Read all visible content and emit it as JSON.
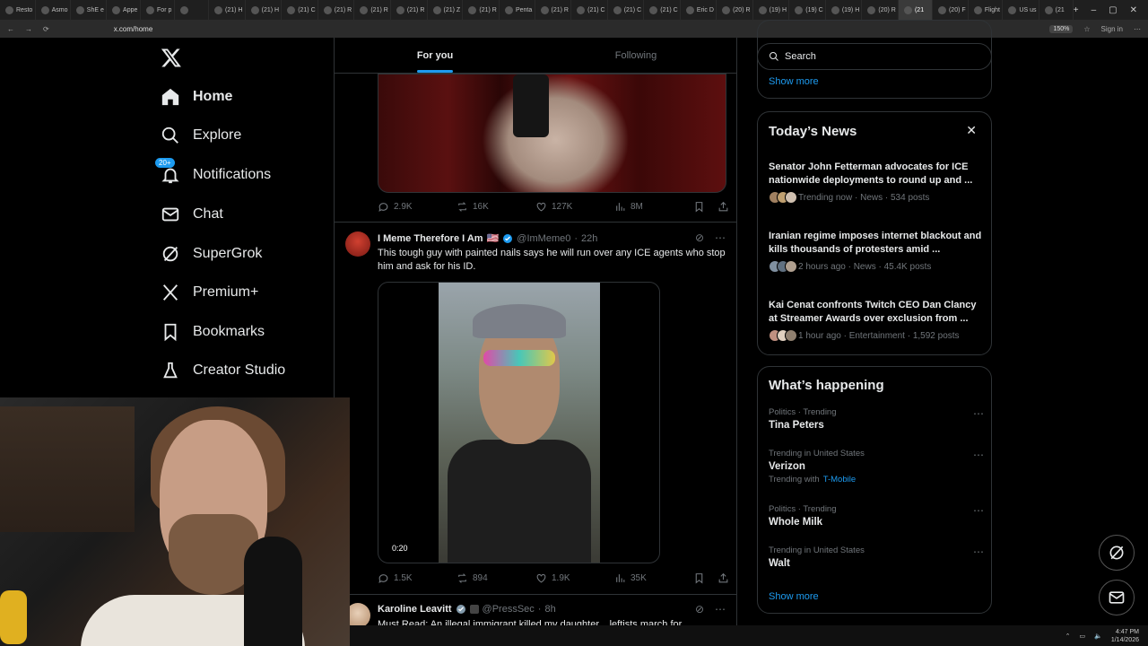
{
  "browser": {
    "tabs": [
      {
        "label": "Resto"
      },
      {
        "label": "Asmo"
      },
      {
        "label": "ShE e"
      },
      {
        "label": "Appe"
      },
      {
        "label": "For p"
      },
      {
        "label": ""
      },
      {
        "label": "(21) H"
      },
      {
        "label": "(21) H"
      },
      {
        "label": "(21) C"
      },
      {
        "label": "(21) R"
      },
      {
        "label": "(21) R"
      },
      {
        "label": "(21) R"
      },
      {
        "label": "(21) Z"
      },
      {
        "label": "(21) R"
      },
      {
        "label": "Penta"
      },
      {
        "label": "(21) R"
      },
      {
        "label": "(21) C"
      },
      {
        "label": "(21) C"
      },
      {
        "label": "(21) C"
      },
      {
        "label": "Eric D"
      },
      {
        "label": "(20) R"
      },
      {
        "label": "(19) H"
      },
      {
        "label": "(19) C"
      },
      {
        "label": "(19) H"
      },
      {
        "label": "(20) R"
      },
      {
        "label": "(21"
      },
      {
        "label": "(20) F"
      },
      {
        "label": "Flight"
      },
      {
        "label": "US us"
      },
      {
        "label": "(21"
      }
    ],
    "active_tab_index": 25,
    "url": "x.com/home",
    "zoom": "150%",
    "sign_in": "Sign in"
  },
  "nav": {
    "items": [
      {
        "label": "Home",
        "icon": "home-icon"
      },
      {
        "label": "Explore",
        "icon": "search-icon"
      },
      {
        "label": "Notifications",
        "icon": "bell-icon",
        "badge": "20+"
      },
      {
        "label": "Chat",
        "icon": "mail-icon"
      },
      {
        "label": "SuperGrok",
        "icon": "grok-icon"
      },
      {
        "label": "Premium+",
        "icon": "x-icon"
      },
      {
        "label": "Bookmarks",
        "icon": "bookmark-icon"
      },
      {
        "label": "Creator Studio",
        "icon": "flask-icon"
      }
    ]
  },
  "feed": {
    "tabs": [
      "For you",
      "Following"
    ],
    "post1": {
      "replies": "2.9K",
      "reposts": "16K",
      "likes": "127K",
      "views": "8M"
    },
    "post2": {
      "name": "I Meme Therefore I Am",
      "flag": "🇺🇸",
      "handle": "@ImMeme0",
      "time": "22h",
      "text": "This tough guy with painted nails says he will run over any ICE agents who stop him and ask for his ID.",
      "video_duration": "0:20",
      "replies": "1.5K",
      "reposts": "894",
      "likes": "1.9K",
      "views": "35K"
    },
    "post3": {
      "name": "Karoline Leavitt",
      "handle": "@PressSec",
      "time": "8h",
      "text": "Must Read: An illegal immigrant killed my daughter... leftists march for"
    }
  },
  "right": {
    "search_placeholder": "Search",
    "show_more_top": "Show more",
    "todays_news": {
      "title": "Today’s News",
      "items": [
        {
          "title": "Senator John Fetterman advocates for ICE nationwide deployments to round up and ...",
          "meta": "Trending now · News · 534 posts"
        },
        {
          "title": "Iranian regime imposes internet blackout and kills thousands of protesters amid ...",
          "meta": "2 hours ago · News · 45.4K posts"
        },
        {
          "title": "Kai Cenat confronts Twitch CEO Dan Clancy at Streamer Awards over exclusion from ...",
          "meta": "1 hour ago · Entertainment · 1,592 posts"
        }
      ]
    },
    "whats_happening": {
      "title": "What’s happening",
      "items": [
        {
          "category": "Politics · Trending",
          "name": "Tina Peters",
          "with": "",
          "with_link": ""
        },
        {
          "category": "Trending in United States",
          "name": "Verizon",
          "with": "Trending with",
          "with_link": "T-Mobile"
        },
        {
          "category": "Politics · Trending",
          "name": "Whole Milk",
          "with": "",
          "with_link": ""
        },
        {
          "category": "Trending in United States",
          "name": "Walt",
          "with": "",
          "with_link": ""
        }
      ],
      "show_more": "Show more"
    }
  },
  "taskbar": {
    "time": "4:47 PM",
    "date": "1/14/2026"
  },
  "colors": {
    "accent": "#1d9bf0",
    "border": "#2f3336",
    "muted": "#71767b"
  }
}
